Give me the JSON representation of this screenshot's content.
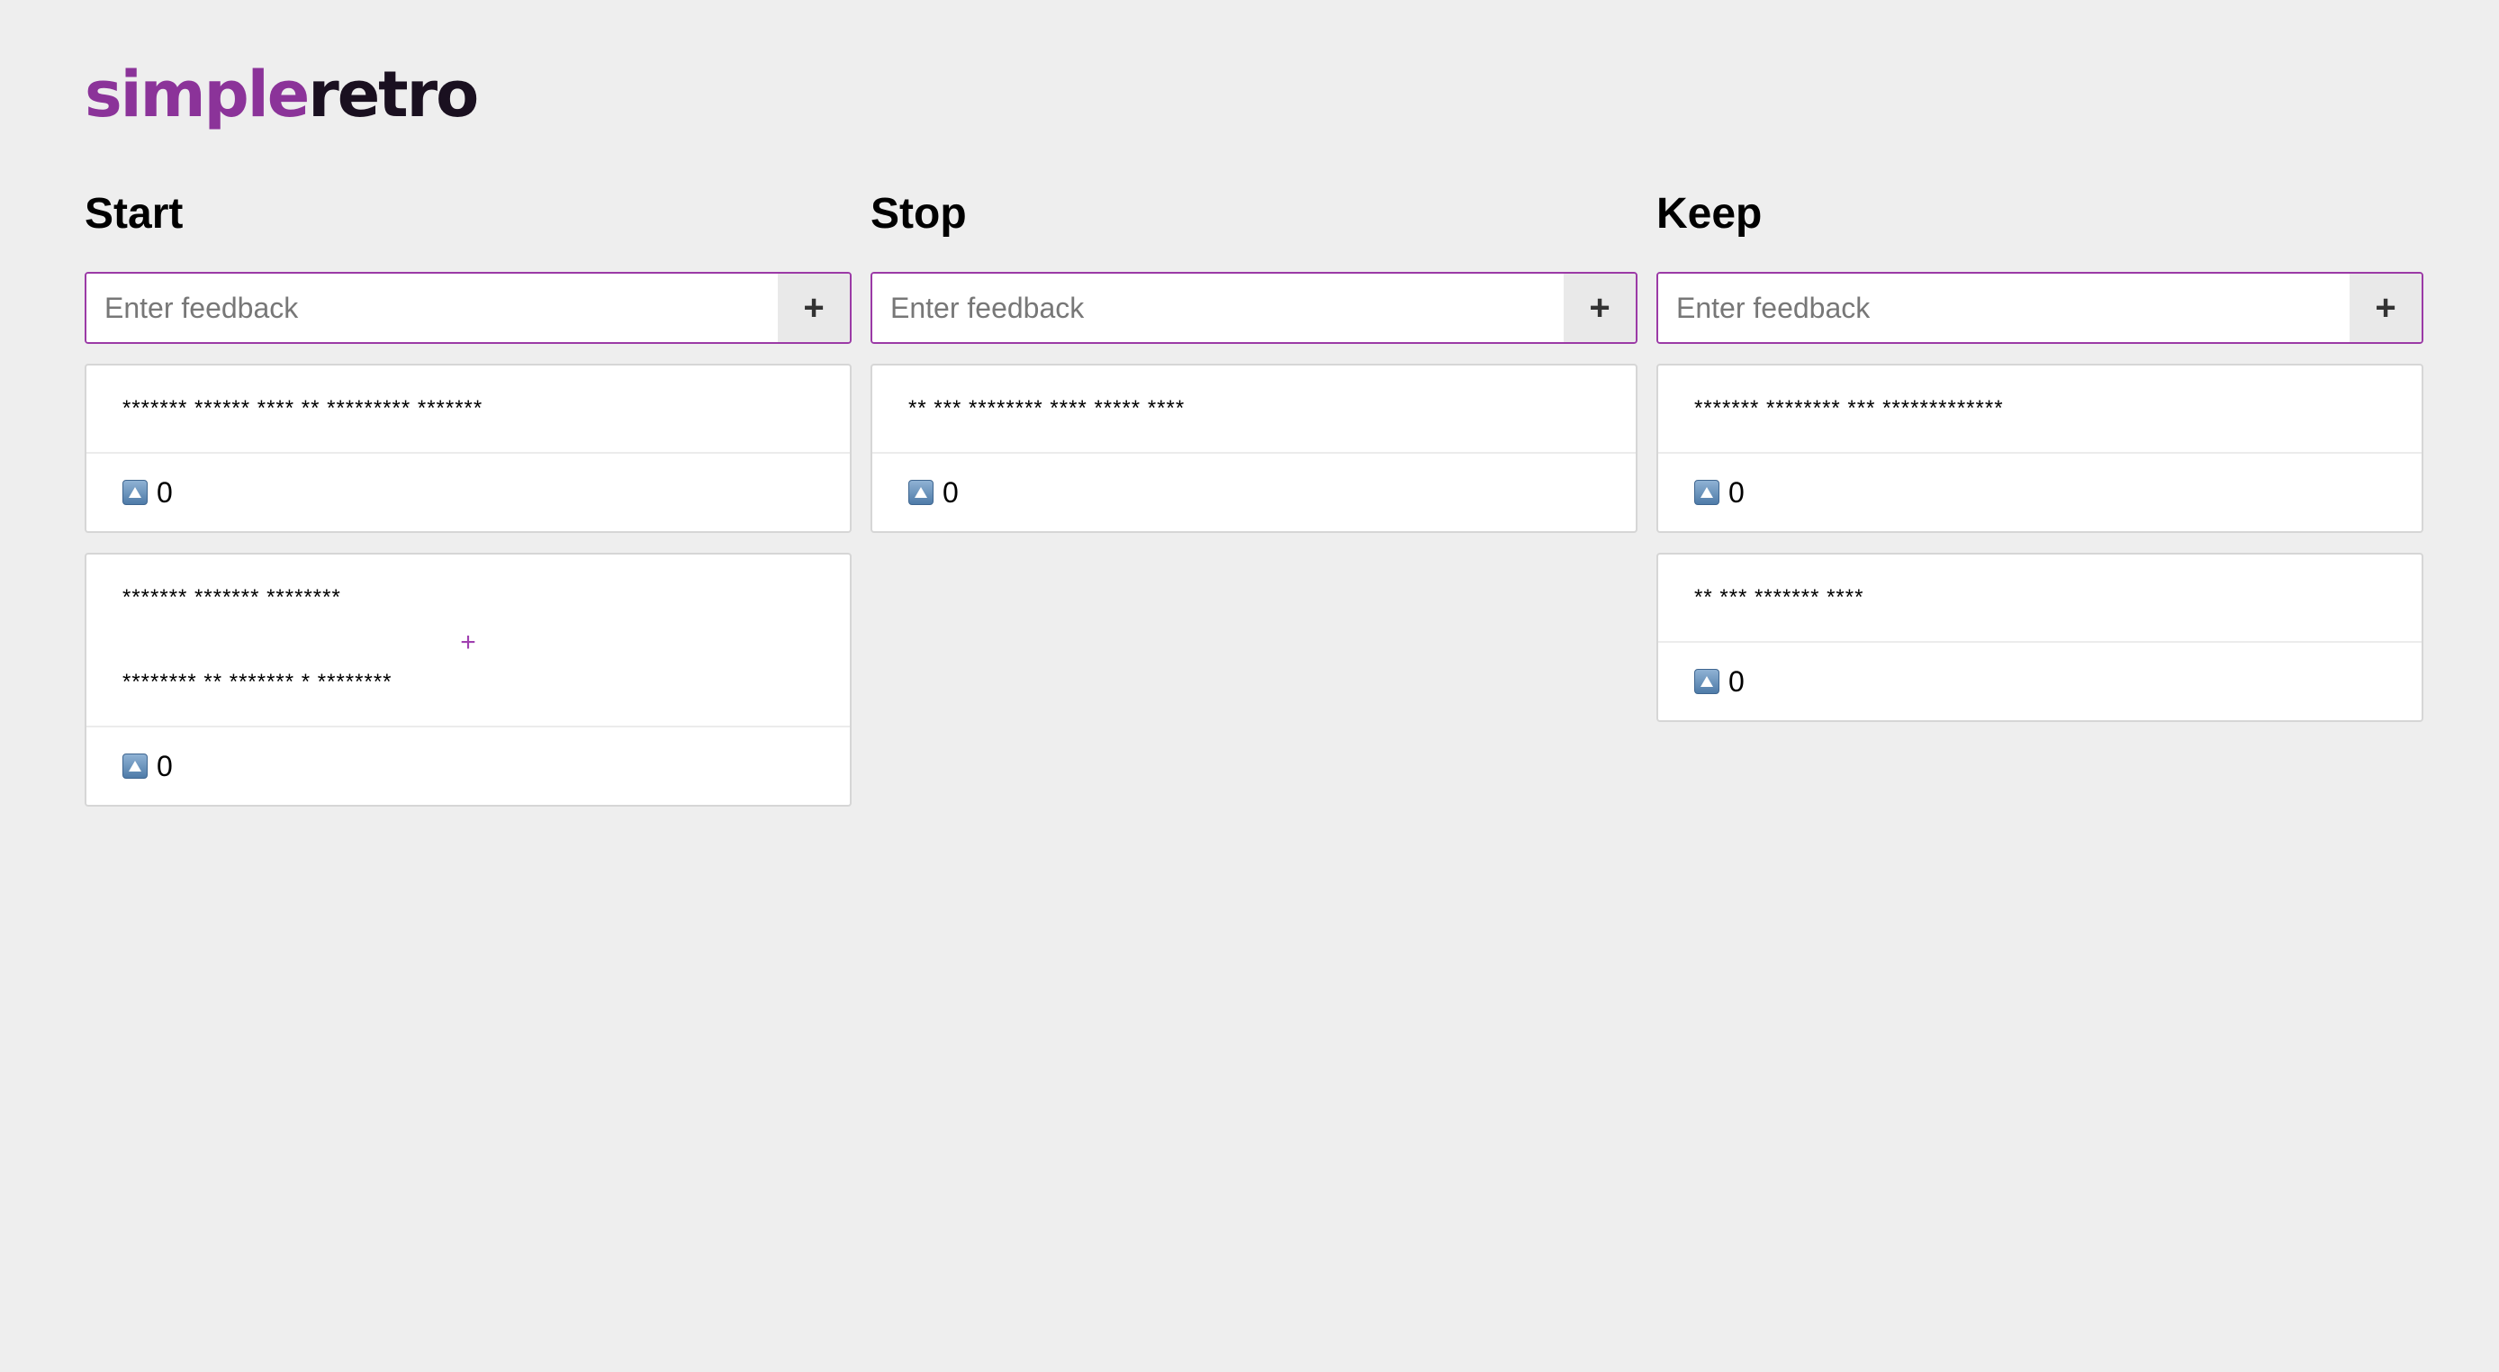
{
  "app": {
    "logo_part1": "simple",
    "logo_part2": "retro"
  },
  "colors": {
    "brand": "#8b3399",
    "accent_border": "#9b3aa6",
    "background": "#eeeeee"
  },
  "columns": [
    {
      "title": "Start",
      "input_placeholder": "Enter feedback",
      "add_label": "+",
      "cards": [
        {
          "lines": [
            "******* ****** **** ** ********* *******"
          ],
          "votes": "0"
        },
        {
          "lines": [
            "******* ******* ********",
            "+",
            "******** ** ******* * ********"
          ],
          "votes": "0"
        }
      ]
    },
    {
      "title": "Stop",
      "input_placeholder": "Enter feedback",
      "add_label": "+",
      "cards": [
        {
          "lines": [
            "** *** ******** **** ***** ****"
          ],
          "votes": "0"
        }
      ]
    },
    {
      "title": "Keep",
      "input_placeholder": "Enter feedback",
      "add_label": "+",
      "cards": [
        {
          "lines": [
            "******* ******** *** *************"
          ],
          "votes": "0"
        },
        {
          "lines": [
            "** *** ******* ****"
          ],
          "votes": "0"
        }
      ]
    }
  ],
  "icons": {
    "vote": "upvote-arrow-icon",
    "add": "plus-icon"
  }
}
